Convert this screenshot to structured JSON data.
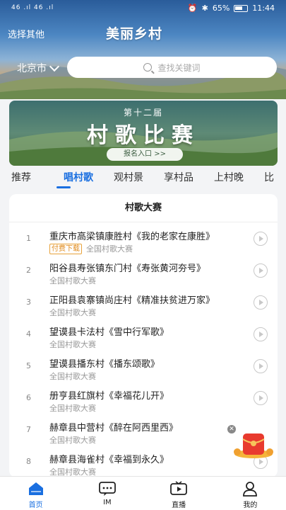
{
  "status_bar": {
    "signal_left": "46 .ıl 46 .ıl",
    "battery_pct": "65%",
    "time": "11:44"
  },
  "header": {
    "select_other": "选择其他",
    "app_title": "美丽乡村",
    "city": "北京市",
    "search_placeholder": "查找关键词"
  },
  "banner": {
    "edition": "第十二届",
    "title": "村歌比赛",
    "entry": "报名入口 >>"
  },
  "tabs": [
    {
      "label": "推荐"
    },
    {
      "label": "唱村歌",
      "active": true
    },
    {
      "label": "观村景"
    },
    {
      "label": "享村品"
    },
    {
      "label": "上村晚"
    },
    {
      "label": "比"
    }
  ],
  "card": {
    "title": "村歌大赛",
    "rows": [
      {
        "num": "1",
        "name": "重庆市高梁镇康胜村《我的老家在康胜》",
        "badge": "付费下载",
        "sub": "全国村歌大赛"
      },
      {
        "num": "2",
        "name": "阳谷县寿张镇东门村《寿张黄河夯号》",
        "sub": "全国村歌大赛"
      },
      {
        "num": "3",
        "name": "正阳县袁寨镇尚庄村《精准扶贫进万家》",
        "sub": "全国村歌大赛"
      },
      {
        "num": "4",
        "name": "望谟县卡法村《雪中行军歌》",
        "sub": "全国村歌大赛"
      },
      {
        "num": "5",
        "name": "望谟县播东村《播东颂歌》",
        "sub": "全国村歌大赛"
      },
      {
        "num": "6",
        "name": "册亨县红旗村《幸福花儿开》",
        "sub": "全国村歌大赛"
      },
      {
        "num": "7",
        "name": "赫章县中营村《醉在阿西里西》",
        "sub": "全国村歌大赛"
      },
      {
        "num": "8",
        "name": "赫章县海雀村《幸福到永久》",
        "sub": "全国村歌大赛"
      }
    ]
  },
  "bottom_nav": [
    {
      "label": "首页",
      "icon": "home-icon",
      "active": true
    },
    {
      "label": "IM",
      "icon": "chat-icon"
    },
    {
      "label": "直播",
      "icon": "tv-icon"
    },
    {
      "label": "我的",
      "icon": "profile-icon"
    }
  ],
  "colors": {
    "accent": "#1a6fe0",
    "badge": "#e08a1a",
    "envelope": "#e83a2e"
  }
}
